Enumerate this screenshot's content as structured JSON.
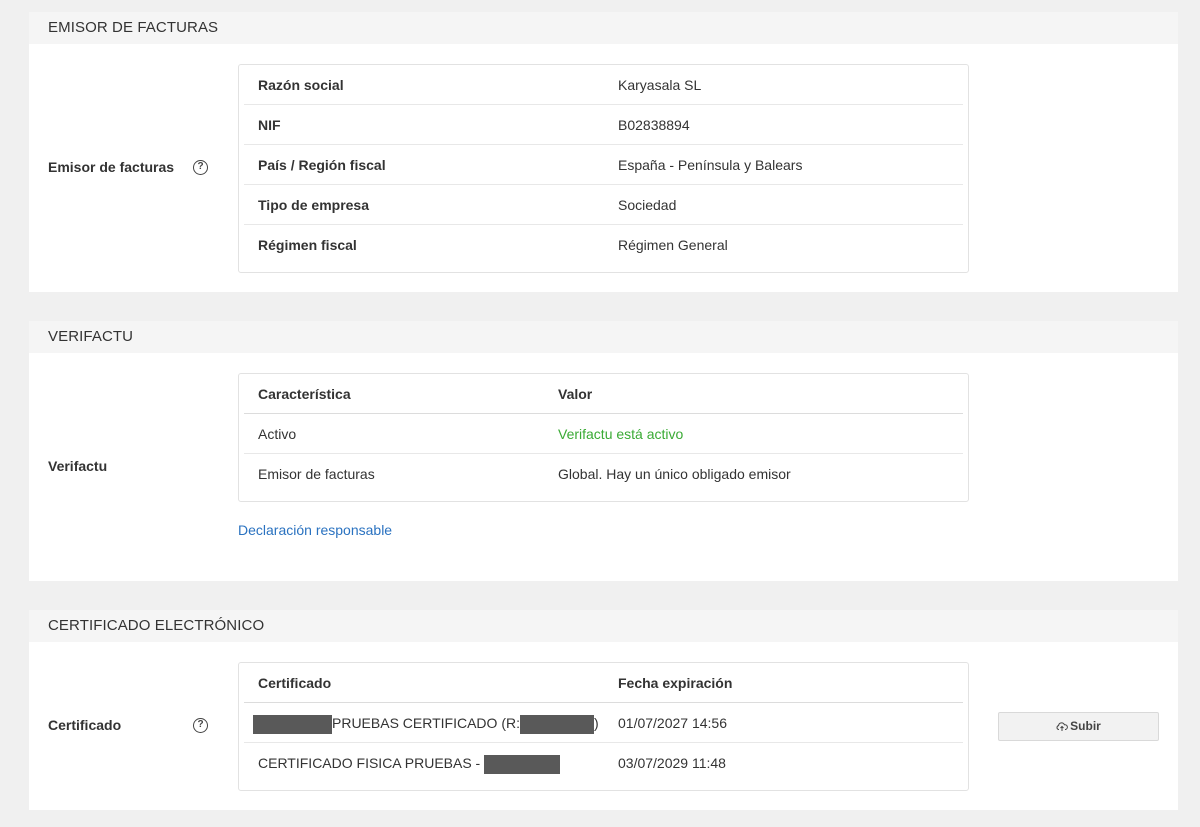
{
  "emisor": {
    "section_title": "EMISOR DE FACTURAS",
    "row_label": "Emisor de facturas",
    "help_icon": "?",
    "rows": [
      {
        "label": "Razón social",
        "value": "Karyasala SL"
      },
      {
        "label": "NIF",
        "value": "B02838894"
      },
      {
        "label": "País / Región fiscal",
        "value": "España - Península y Balears"
      },
      {
        "label": "Tipo de empresa",
        "value": "Sociedad"
      },
      {
        "label": "Régimen fiscal",
        "value": "Régimen General"
      }
    ]
  },
  "verifactu": {
    "section_title": "VERIFACTU",
    "row_label": "Verifactu",
    "headers": {
      "col1": "Característica",
      "col2": "Valor"
    },
    "rows": [
      {
        "label": "Activo",
        "value": "Verifactu está activo",
        "value_color": "#3aaa35"
      },
      {
        "label": "Emisor de facturas",
        "value": "Global. Hay un único obligado emisor"
      }
    ],
    "link": "Declaración responsable"
  },
  "certificado": {
    "section_title": "CERTIFICADO ELECTRÓNICO",
    "row_label": "Certificado",
    "help_icon": "?",
    "headers": {
      "col1": "Certificado",
      "col2": "Fecha expiración"
    },
    "rows": [
      {
        "name_text": "PRUEBAS CERTIFICADO (R:",
        "name_suffix": ")",
        "expiry": "01/07/2027 14:56"
      },
      {
        "name_text": "CERTIFICADO FISICA PRUEBAS - ",
        "expiry": "03/07/2029 11:48"
      }
    ],
    "upload_button": "Subir",
    "upload_icon": "cloud-upload-icon"
  }
}
